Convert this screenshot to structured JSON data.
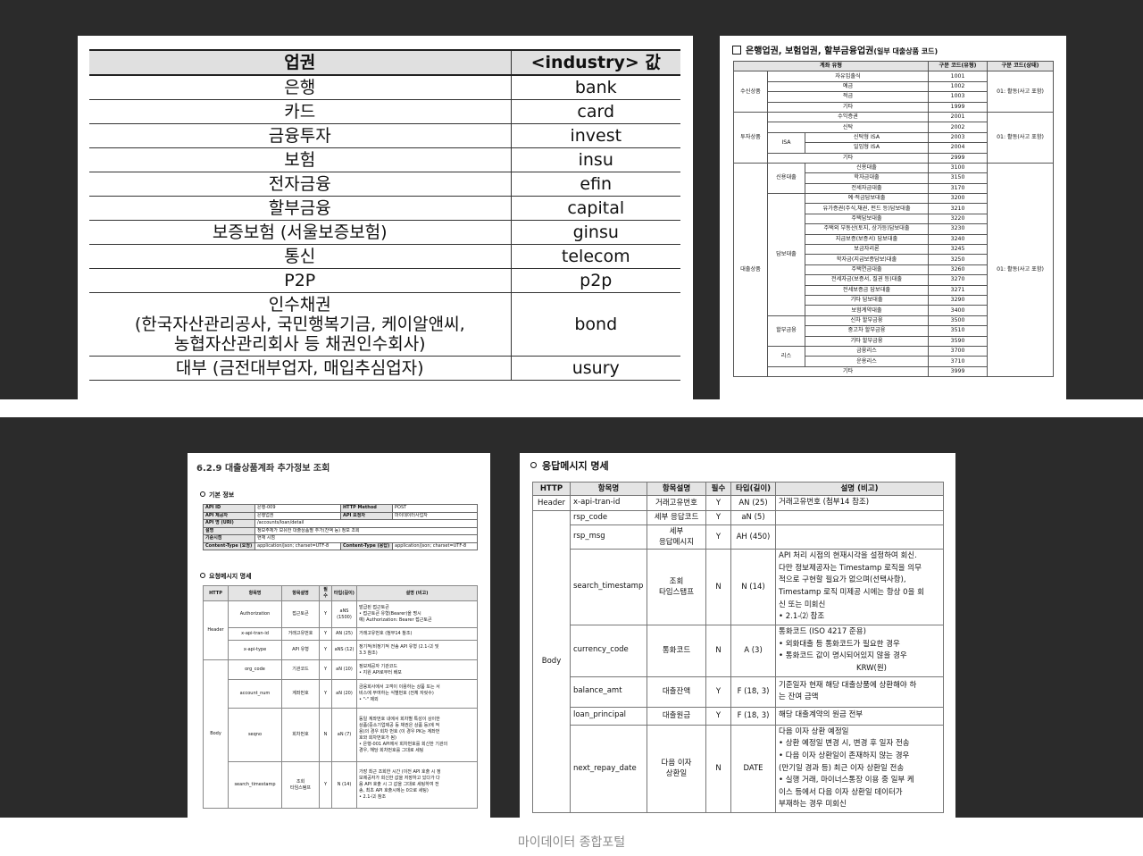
{
  "doc1": {
    "headers": [
      "업권",
      "<industry> 값"
    ],
    "rows": [
      [
        "은행",
        "bank"
      ],
      [
        "카드",
        "card"
      ],
      [
        "금융투자",
        "invest"
      ],
      [
        "보험",
        "insu"
      ],
      [
        "전자금융",
        "efin"
      ],
      [
        "할부금융",
        "capital"
      ],
      [
        "보증보험 (서울보증보험)",
        "ginsu"
      ],
      [
        "통신",
        "telecom"
      ],
      [
        "P2P",
        "p2p"
      ]
    ],
    "bond": {
      "l1": "인수채권",
      "l2": "(한국자산관리공사, 국민행복기금, 케이알앤씨,",
      "l3": "농협자산관리회사 등 채권인수회사)",
      "value": "bond"
    },
    "last": [
      "대부 (금전대부업자, 매입추심업자)",
      "usury"
    ]
  },
  "doc2": {
    "title": "은행업권, 보험업권, 할부금융업권",
    "title_note": "(일부 대출상품 코드)",
    "headers": [
      "계좌 유형",
      "구분 코드(유형)",
      "구분 코드(상태)"
    ],
    "status": "01: 활동(사고 포함)",
    "groups": {
      "deposit": "수신상품",
      "invest": "투자상품",
      "isa": "ISA",
      "loan": "대출상품",
      "credit": "신용대출",
      "secured": "담보대출",
      "install": "할부금융",
      "lease": "리스"
    },
    "deposit_rows": [
      [
        "자유입출식",
        "1001"
      ],
      [
        "예금",
        "1002"
      ],
      [
        "적금",
        "1003"
      ],
      [
        "기타",
        "1999"
      ]
    ],
    "invest_rows": [
      [
        "수익증권",
        "2001"
      ],
      [
        "신탁",
        "2002"
      ]
    ],
    "isa_rows": [
      [
        "신탁형 ISA",
        "2003"
      ],
      [
        "일임형 ISA",
        "2004"
      ]
    ],
    "invest_other": [
      "기타",
      "2999"
    ],
    "credit_rows": [
      [
        "신용대출",
        "3100"
      ],
      [
        "학자금대출",
        "3150"
      ],
      [
        "전세자금대출",
        "3170"
      ]
    ],
    "secured_rows": [
      [
        "예·적금담보대출",
        "3200"
      ],
      [
        "유가증권(주식,채권, 펀드 등)담보대출",
        "3210"
      ],
      [
        "주택담보대출",
        "3220"
      ],
      [
        "주택외 부동산(토지, 상가등)담보대출",
        "3230"
      ],
      [
        "지급보증(보증서) 담보대출",
        "3240"
      ],
      [
        "보금자리론",
        "3245"
      ],
      [
        "학자금(지급보증담보)대출",
        "3250"
      ],
      [
        "주택연금대출",
        "3260"
      ],
      [
        "전세자금(보증서, 질권 등)대출",
        "3270"
      ],
      [
        "전세보증금 담보대출",
        "3271"
      ],
      [
        "기타 담보대출",
        "3290"
      ],
      [
        "보험계약대출",
        "3400"
      ]
    ],
    "install_rows": [
      [
        "신차 할부금융",
        "3500"
      ],
      [
        "중고차 할부금융",
        "3510"
      ],
      [
        "기타 할부금융",
        "3590"
      ]
    ],
    "lease_rows": [
      [
        "금융리스",
        "3700"
      ],
      [
        "운용리스",
        "3710"
      ]
    ],
    "loan_other": [
      "기타",
      "3999"
    ]
  },
  "doc3": {
    "heading": "6.2.9 대출상품계좌 추가정보 조회",
    "basic_title": "기본 정보",
    "basic": {
      "api_id_k": "API ID",
      "api_id_v": "은행-009",
      "method_k": "HTTP Method",
      "method_v": "POST",
      "provider_k": "API 제공자",
      "provider_v": "은행업권",
      "caller_k": "API 요청자",
      "caller_v": "마이데이터사업자",
      "uri_k": "API 명 (URI)",
      "uri_v": "/accounts/loan/detail",
      "desc_k": "설명",
      "desc_v": "정보주체가 보유한 대출상품별 추가(잔액 등) 정보 조회",
      "std_k": "기준시점",
      "std_v": "현재 시점",
      "ctreq_k": "Content-Type (요청)",
      "ctreq_v": "application/json; charset=UTF-8",
      "ctres_k": "Content-Type (응답)",
      "ctres_v": "application/json; charset=UTF-8"
    },
    "req_title": "요청메시지 명세",
    "headers": [
      "HTTP",
      "항목명",
      "항목설명",
      "필수",
      "타입(길이)",
      "설명 (비고)"
    ],
    "group_header": "Header",
    "group_body": "Body",
    "rows": [
      {
        "name": "Authorization",
        "label": "접근토큰",
        "req": "Y",
        "type": "aNS (1500)",
        "d1": "발급된 접근토큰",
        "d2": "• 접근토큰 유형(Bearer)을 명시",
        "d3": "예) Authorization: Bearer 접근토큰"
      },
      {
        "name": "x-api-tran-id",
        "label": "거래고유번호",
        "req": "Y",
        "type": "AN (25)",
        "d1": "거래고유번호 (첨부14 참조)"
      },
      {
        "name": "x-api-type",
        "label": "API 유형",
        "req": "Y",
        "type": "aNS (12)",
        "d1": "정기적/비정기적 전송 API 유형 (2.1-⑵ 및",
        "d2": "3.3 참조)"
      },
      {
        "name": "org_code",
        "label": "기관코드",
        "req": "Y",
        "type": "aN (10)",
        "d1": "정보제공자 기관코드",
        "d2": "• 지원 API로부터 배포"
      },
      {
        "name": "account_num",
        "label": "계좌번호",
        "req": "Y",
        "type": "aN (20)",
        "d1": "금융회사에서 고객이 이용하는 상품 또는 서",
        "d2": "비스에 부여하는 식별번호 (전체 자릿수)",
        "d3": "• \"-\" 제외"
      },
      {
        "name": "seqno",
        "label": "회차번호",
        "req": "N",
        "type": "aN (7)",
        "d1": "동일 계좌번호 내에서 회차별 특성이 상이한",
        "d2": "상품(중소기업제공 등 채권은 상품 등)에 적",
        "d3": "용)의 경우 회차 번호 (이 경우 PK는 계좌번",
        "d4": "호와 회차번호가 됨)",
        "d5": "• 은행-001 API에서 회차번호를 회신한 기관의",
        "d6": "경우, 해당 회차번호를 그대로 세팅"
      },
      {
        "name": "search_timestamp",
        "label": "조회",
        "label2": "타임스탬프",
        "req": "Y",
        "type": "N (14)",
        "d1": "가장 최근 조회한 시간 (이전 API 호출 시 정",
        "d2": "보제공자가 회신한 값을 저장하고 있다가 다",
        "d3": "음 API 호출 시 그 값을 그대로 세팅하여 전",
        "d4": "송, 최초 API 호출시에는 0으로 세팅)",
        "d5": "• 2.1-⑵ 참조"
      }
    ]
  },
  "doc4": {
    "heading": "응답메시지 명세",
    "headers": [
      "HTTP",
      "항목명",
      "항목설명",
      "필수",
      "타입(길이)",
      "설명 (비고)"
    ],
    "group_header": "Header",
    "group_body": "Body",
    "rows": [
      {
        "name": "x-api-tran-id",
        "label": "거래고유번호",
        "req": "Y",
        "type": "AN (25)",
        "d": [
          "거래고유번호 (첨부14 참조)"
        ]
      },
      {
        "name": "rsp_code",
        "label": "세부 응답코드",
        "req": "Y",
        "type": "aN (5)",
        "d": []
      },
      {
        "name": "rsp_msg",
        "label": "세부",
        "label2": "응답메시지",
        "req": "Y",
        "type": "AH (450)",
        "d": []
      },
      {
        "name": "search_timestamp",
        "label": "조회",
        "label2": "타임스탬프",
        "req": "N",
        "type": "N (14)",
        "d": [
          "API 처리 시점의 현재시각을 설정하여 회신.",
          "다만 정보제공자는 Timestamp 로직을 의무",
          "적으로 구현할 필요가 없으며(선택사항),",
          "Timestamp 로직 미제공 시에는 항상 0을 회",
          "신 또는 미회신",
          "• 2.1-⑵ 참조"
        ]
      },
      {
        "name": "currency_code",
        "label": "통화코드",
        "req": "N",
        "type": "A (3)",
        "d": [
          "통화코드 (ISO 4217 준용)",
          "• 외화대출 등 통화코드가 필요한 경우",
          "• 통화코드 값이 명시되어있지 않을 경우",
          "KRW(원)"
        ]
      },
      {
        "name": "balance_amt",
        "label": "대출잔액",
        "req": "Y",
        "type": "F (18, 3)",
        "d": [
          "기준일자 현재 해당 대출상품에 상환해야 하",
          "는 잔여 금액"
        ]
      },
      {
        "name": "loan_principal",
        "label": "대출원금",
        "req": "Y",
        "type": "F (18, 3)",
        "d": [
          "해당 대출계약의 원금 전부"
        ]
      },
      {
        "name": "next_repay_date",
        "label": "다음 이자",
        "label2": "상환일",
        "req": "N",
        "type": "DATE",
        "d": [
          "다음 이자 상환 예정일",
          "• 상환 예정일 변경 시, 변경 후 일자 전송",
          "• 다음 이자 상환일이 존재하지 않는 경우",
          "(만기일 경과 등) 최근 이자 상환일 전송",
          "• 실행 거래, 마이너스통장 이용 중 일부 케",
          "이스 등에서 다음 이자 상환일 데이터가",
          "부재하는 경우 미회신"
        ]
      }
    ]
  },
  "caption": "마이데이터 종합포털"
}
